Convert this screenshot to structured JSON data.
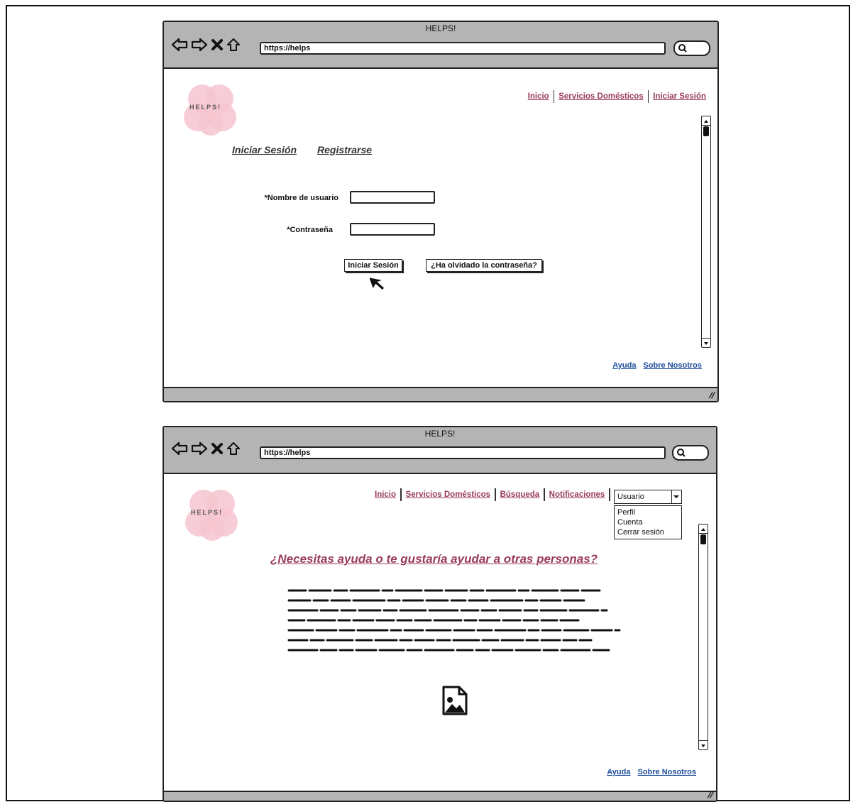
{
  "window1": {
    "title": "HELPS!",
    "url": "https://helps",
    "logo_text": "HELPS!",
    "nav": [
      "Inicio",
      "Servicios Domésticos",
      "Iniciar Sesión"
    ],
    "tabs": [
      "Iniciar Sesión",
      "Registrarse"
    ],
    "form": {
      "username_label": "*Nombre de usuario",
      "password_label": "*Contraseña",
      "login_button": "Iniciar Sesión",
      "forgot_button": "¿Ha olvidado la contraseña?"
    },
    "footer": [
      "Ayuda",
      "Sobre Nosotros"
    ]
  },
  "window2": {
    "title": "HELPS!",
    "url": "https://helps",
    "logo_text": "HELPS!",
    "nav": [
      "Inicio",
      "Servicios Domésticos",
      "Búsqueda",
      "Notificaciones"
    ],
    "user_dropdown": {
      "selected": "Usuario",
      "options": [
        "Perfil",
        "Cuenta",
        "Cerrar sesión"
      ]
    },
    "headline": "¿Necesitas ayuda o te gustaría ayudar a otras personas?",
    "footer": [
      "Ayuda",
      "Sobre Nosotros"
    ]
  },
  "colors": {
    "nav_link": "#9a3a5f",
    "footer_link": "#1f4e9c",
    "logo_pink": "#f6c5d0",
    "chrome_gray": "#b4b4b4"
  },
  "icons": [
    "back-arrow-icon",
    "forward-arrow-icon",
    "stop-icon",
    "home-icon",
    "search-icon",
    "image-placeholder-icon",
    "mouse-cursor-icon"
  ]
}
